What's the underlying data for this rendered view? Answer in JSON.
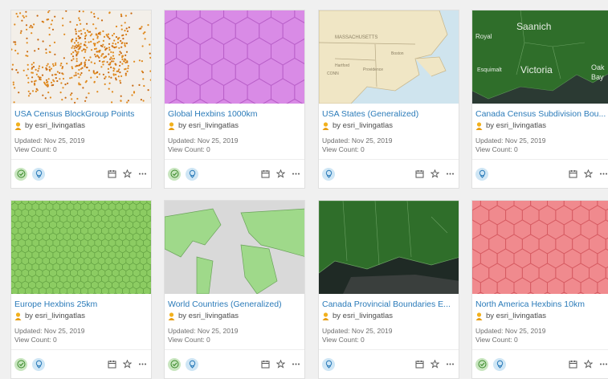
{
  "items": [
    {
      "title": "USA Census BlockGroup Points",
      "owner": "by esri_livingatlas",
      "updated": "Updated: Nov 25, 2019",
      "views": "View Count: 0",
      "badges": [
        "green",
        "blue"
      ],
      "thumb": "points"
    },
    {
      "title": "Global Hexbins 1000km",
      "owner": "by esri_livingatlas",
      "updated": "Updated: Nov 25, 2019",
      "views": "View Count: 0",
      "badges": [
        "green",
        "blue"
      ],
      "thumb": "hex-purple"
    },
    {
      "title": "USA States (Generalized)",
      "owner": "by esri_livingatlas",
      "updated": "Updated: Nov 25, 2019",
      "views": "View Count: 0",
      "badges": [
        "blue"
      ],
      "thumb": "usa-states"
    },
    {
      "title": "Canada Census Subdivision Bou...",
      "owner": "by esri_livingatlas",
      "updated": "Updated: Nov 25, 2019",
      "views": "View Count: 0",
      "badges": [
        "blue"
      ],
      "thumb": "canada-sub"
    },
    {
      "title": "Europe Hexbins 25km",
      "owner": "by esri_livingatlas",
      "updated": "Updated: Nov 25, 2019",
      "views": "View Count: 0",
      "badges": [
        "green",
        "blue"
      ],
      "thumb": "hex-green"
    },
    {
      "title": "World Countries (Generalized)",
      "owner": "by esri_livingatlas",
      "updated": "Updated: Nov 25, 2019",
      "views": "View Count: 0",
      "badges": [
        "green",
        "blue"
      ],
      "thumb": "world"
    },
    {
      "title": "Canada Provincial Boundaries E...",
      "owner": "by esri_livingatlas",
      "updated": "Updated: Nov 25, 2019",
      "views": "View Count: 0",
      "badges": [
        "blue"
      ],
      "thumb": "canada-prov"
    },
    {
      "title": "North America Hexbins 10km",
      "owner": "by esri_livingatlas",
      "updated": "Updated: Nov 25, 2019",
      "views": "View Count: 0",
      "badges": [
        "green",
        "blue"
      ],
      "thumb": "hex-red"
    }
  ],
  "map_labels": {
    "canada_sub": [
      "Saanich",
      "Royal",
      "Esquimalt",
      "Victoria",
      "Oak",
      "Bay"
    ],
    "usa_states": [
      "MASSACHUSETTS",
      "CONN",
      "Hartford",
      "Providence",
      "Boston"
    ]
  },
  "icons": {
    "owner": "user-icon",
    "green_badge": "check-circle-icon",
    "blue_badge": "sharing-icon",
    "actions": [
      "add-to-calendar-icon",
      "favorite-star-icon",
      "more-options-icon"
    ]
  },
  "colors": {
    "title": "#2b7bb9",
    "green_badge": "#c9e6c0",
    "blue_badge": "#cfe6f5"
  }
}
